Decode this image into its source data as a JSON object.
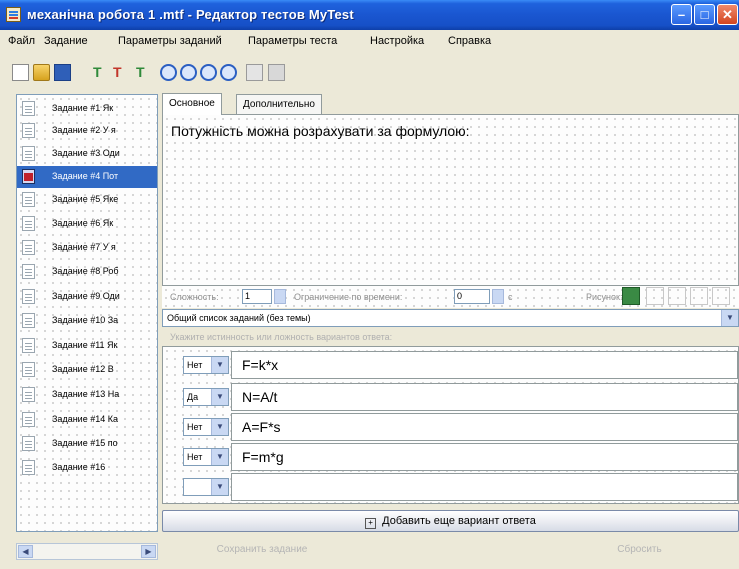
{
  "window": {
    "title": "механічна робота 1 .mtf - Редактор тестов MyTest"
  },
  "menu": [
    "Файл",
    "Задание",
    "Параметры заданий",
    "Параметры теста",
    "Настройка",
    "Справка"
  ],
  "tasks": [
    {
      "label": "Задание #1 Як"
    },
    {
      "label": "Задание #2 У я"
    },
    {
      "label": "Задание #3 Оди"
    },
    {
      "label": "Задание #4 Пот"
    },
    {
      "label": "Задание #5 Яке"
    },
    {
      "label": "Задание #6 Як"
    },
    {
      "label": "Задание #7 У я"
    },
    {
      "label": "Задание #8 Роб"
    },
    {
      "label": "Задание #9 Оди"
    },
    {
      "label": "Задание #10 За"
    },
    {
      "label": "Задание #11 Як"
    },
    {
      "label": "Задание #12 В"
    },
    {
      "label": "Задание #13 На"
    },
    {
      "label": "Задание #14 Ка"
    },
    {
      "label": "Задание #15 по"
    },
    {
      "label": "Задание #16"
    }
  ],
  "selected_task_index": 3,
  "tabs": [
    "Основное",
    "Дополнительно"
  ],
  "question_text": "Потужність можна розрахувати за формулою:",
  "params": {
    "complexity_label": "Сложность:",
    "complexity_value": "1",
    "time_limit_label": "Ограничение по времени:",
    "time_limit_value": "0",
    "time_unit": "с",
    "picture_label": "Рисунок:"
  },
  "theme": "Общий список заданий (без темы)",
  "hint": "Укажите истинность или ложность вариантов ответа:",
  "answers": [
    {
      "truth": "Нет",
      "text": "F=k*x"
    },
    {
      "truth": "Да",
      "text": "N=A/t"
    },
    {
      "truth": "Нет",
      "text": "A=F*s"
    },
    {
      "truth": "Нет",
      "text": "F=m*g"
    },
    {
      "truth": "",
      "text": ""
    }
  ],
  "add_answer_label": "Добавить еще вариант ответа",
  "footer": {
    "save_label": "Сохранить задание",
    "reset_label": "Сбросить"
  },
  "colors": {
    "titlebar": "#1f62dd",
    "selection": "#316ac5",
    "background": "#ece9d8"
  }
}
